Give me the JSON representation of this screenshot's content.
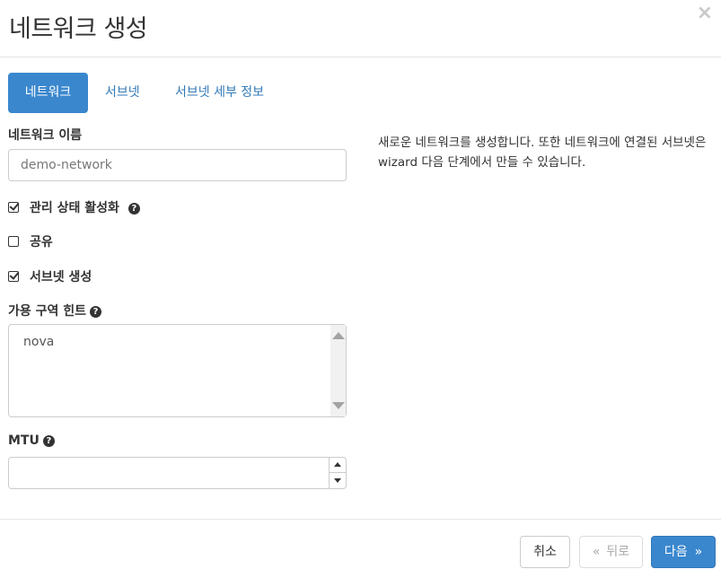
{
  "dialog": {
    "title": "네트워크 생성",
    "close_symbol": "×"
  },
  "tabs": [
    {
      "label": "네트워크",
      "active": true
    },
    {
      "label": "서브넷",
      "active": false
    },
    {
      "label": "서브넷 세부 정보",
      "active": false
    }
  ],
  "form": {
    "network_name": {
      "label": "네트워크 이름",
      "value": "demo-network"
    },
    "admin_state": {
      "label": "관리 상태 활성화",
      "checked": true,
      "help_icon": "question-circle-icon"
    },
    "shared": {
      "label": "공유",
      "checked": false
    },
    "create_subnet": {
      "label": "서브넷 생성",
      "checked": true
    },
    "availability_zone_hints": {
      "label": "가용 구역 힌트",
      "options": [
        "nova"
      ]
    },
    "mtu": {
      "label": "MTU",
      "value": ""
    }
  },
  "description": "새로운 네트워크를 생성합니다. 또한 네트워크에 연결된 서브넷은 wizard 다음 단계에서 만들 수 있습니다.",
  "footer": {
    "cancel_label": "취소",
    "back_label": "뒤로",
    "back_symbol": "«",
    "next_label": "다음",
    "next_symbol": "»"
  },
  "colors": {
    "primary": "#3a87ce",
    "link": "#337ab7",
    "border": "#cccccc"
  }
}
